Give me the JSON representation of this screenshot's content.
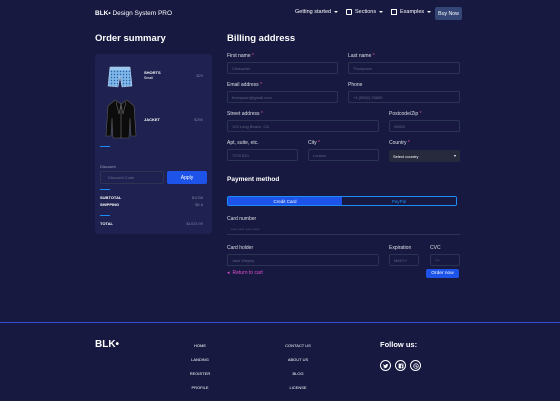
{
  "navbar": {
    "brand_bold": "BLK•",
    "brand_rest": " Design System PRO",
    "getting_started": "Getting started",
    "sections": "Sections",
    "examples": "Examples",
    "buy_now": "Buy Now"
  },
  "order": {
    "title": "Order summary",
    "items": [
      {
        "name": "SHORTS",
        "sub": "Small",
        "price": "$29"
      },
      {
        "name": "JACKET",
        "sub": "",
        "price": "$290"
      }
    ],
    "discount_label": "Discount",
    "discount_placeholder": "Discount Code",
    "apply_label": "Apply",
    "subtotal_label": "SUBTOTAL",
    "subtotal_value": "$1038",
    "shipping_label": "SHIPPING",
    "shipping_value": "$5.8",
    "total_label": "TOTAL",
    "total_value": "$1023.99"
  },
  "billing": {
    "title": "Billing address",
    "first_name_label": "First name",
    "first_name_placeholder": "Cristopher",
    "last_name_label": "Last name",
    "last_name_placeholder": "Thompson",
    "email_label": "Email address",
    "email_placeholder": "thompson@gmail.com",
    "phone_label": "Phone",
    "phone_placeholder": "+4 (5552) 33689",
    "street_label": "Street address",
    "street_placeholder": "123 Long Beach, CA",
    "postcode_label": "Postcode/Zip",
    "postcode_placeholder": "98800",
    "apt_label": "Apt, suite, etc.",
    "apt_placeholder": "7078 B21",
    "city_label": "City",
    "city_placeholder": "London",
    "country_label": "Country",
    "country_value": "Select country",
    "required_mark": "*"
  },
  "payment": {
    "title": "Payment method",
    "tab_credit": "Credit Card",
    "tab_paypal": "PayPal",
    "card_number_label": "Card number",
    "card_number_placeholder": "**** **** **** ****",
    "card_holder_label": "Card holder",
    "card_holder_placeholder": "Jack Wayley",
    "expiration_label": "Expiration",
    "expiration_placeholder": "MM/YY",
    "cvc_label": "CVC",
    "cvc_placeholder": "***",
    "return_label": "Return to cart",
    "order_now": "Order now"
  },
  "footer": {
    "brand": "BLK•",
    "col1": [
      "HOME",
      "LANDING",
      "REGISTER",
      "PROFILE"
    ],
    "col2": [
      "CONTACT US",
      "ABOUT US",
      "BLOG",
      "LICENSE"
    ],
    "follow": "Follow us:",
    "social_icons": [
      "twitter-icon",
      "facebook-icon",
      "dribbble-icon"
    ]
  },
  "colors": {
    "background": "#171941",
    "card": "#1f2251",
    "primary": "#1d53e8",
    "accent_info": "#1d8cf8",
    "link_pink": "#e14eca",
    "required": "#fd5d93"
  }
}
